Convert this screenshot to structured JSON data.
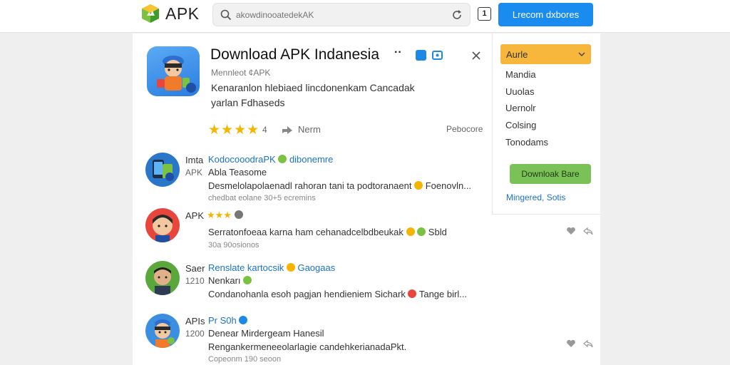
{
  "header": {
    "logo_text": "APK",
    "search_placeholder": "akowdinooatedekAK",
    "badge_number": "1",
    "cta_label": "Lrecom dxbores"
  },
  "app": {
    "title": "Download APK Indanesia",
    "title_suffix": "··",
    "subtitle": "Mennleot ¢APK",
    "description_line1": "Kenaranlon hlebiaed lincdonenkam Cancadak",
    "description_line2": "yarlan Fdhaseds",
    "stars": "★★★★",
    "rating_value": "4",
    "share_label": "Nerm",
    "process_label": "Pebocore"
  },
  "sidebar": {
    "select_label": "Aurle",
    "items": [
      "Mandia",
      "Uuolas",
      "Uernolr",
      "Colsing",
      "Tonodams"
    ],
    "cta_label": "Downloak Bare",
    "link_label": "Mingered, Sotis"
  },
  "comments": [
    {
      "tag": "Imta",
      "sub": "APK",
      "name": "KodocooodraPK",
      "name_badge": "dibonemre",
      "line1": "Abla  Teasome",
      "line2": "Desmelolapolaenadl rahoran tani ta podtoranaent",
      "line2_tail": "Foenovln...",
      "meta": "chedbat eolane  30+5 ecremins"
    },
    {
      "tag": "APK",
      "sub": "",
      "name": "",
      "name_badge": "",
      "line1": "★★★",
      "line2": "Serratonfoeaa karna ham cehanadcelbdbeukak",
      "line2_tail": "Sbld",
      "meta": "30a 90osionos"
    },
    {
      "tag": "Saer",
      "sub": "1210",
      "name": "Renslate kartocsik",
      "name_badge": "Gaogaas",
      "line1": "Nenkarı",
      "line2": "Condanohanla esoh pagjan hendieniem Sichark",
      "line2_tail": "Tange birl...",
      "meta": ""
    },
    {
      "tag": "APIs",
      "sub": "1200",
      "name": "Pr S0h",
      "name_badge": "",
      "line1": "Denear  Mirdergeam  Hanesil",
      "line2": "Rengankermeneeolarlagie candehkerianadaPkt.",
      "line2_tail": "",
      "meta": "Copeonm 190 seoon"
    }
  ],
  "colors": {
    "primary_blue": "#1a8cf0",
    "accent_orange": "#f6b73c",
    "accent_green": "#7ac257",
    "star_yellow": "#f5b400",
    "link_blue": "#1a73c8"
  },
  "icons": [
    "apk-logo-icon",
    "search-icon",
    "refresh-icon",
    "verify-icon",
    "media-icon",
    "close-icon",
    "share-icon",
    "chevron-down-icon",
    "heart-icon",
    "reply-icon"
  ]
}
